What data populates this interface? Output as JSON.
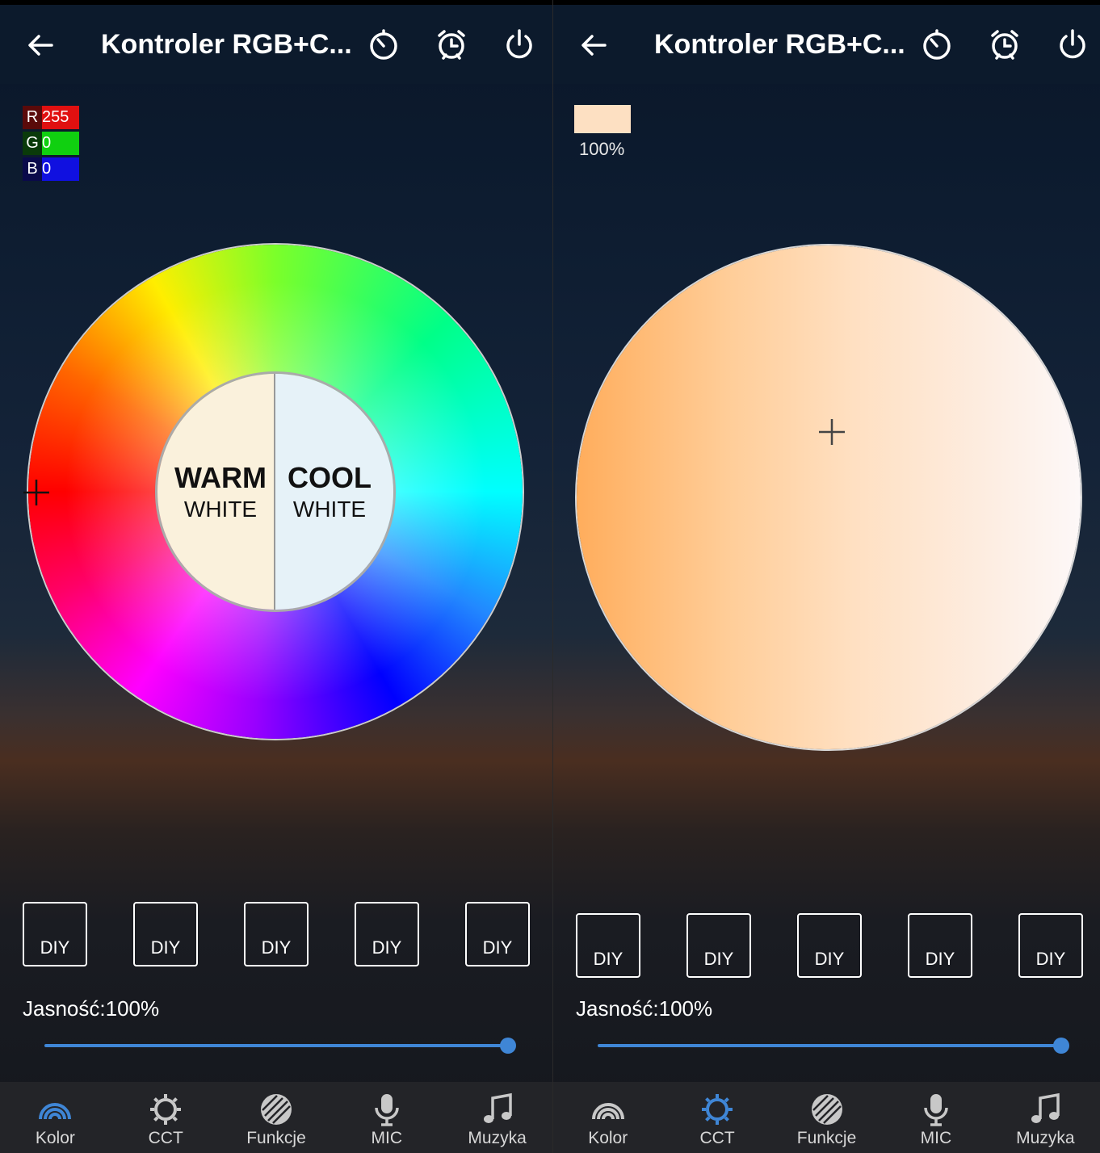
{
  "colors": {
    "accent": "#3f86d6",
    "appbar": "#0c1a2c",
    "nav_bg": "#232428",
    "inactive_icon": "#c8c8c8"
  },
  "left": {
    "app_title": "Kontroler RGB+C...",
    "rgb": {
      "r_label": "R",
      "r_value": "255",
      "g_label": "G",
      "g_value": "0",
      "b_label": "B",
      "b_value": "0"
    },
    "warm": {
      "line1": "WARM",
      "line2": "WHITE"
    },
    "cool": {
      "line1": "COOL",
      "line2": "WHITE"
    },
    "diy": [
      "DIY",
      "DIY",
      "DIY",
      "DIY",
      "DIY"
    ],
    "brightness_label": "Jasność:100%",
    "brightness_value": 1.0,
    "active_tab": "Kolor"
  },
  "right": {
    "app_title": "Kontroler RGB+C...",
    "swatch_color": "#fde0c2",
    "swatch_percent": "100%",
    "diy": [
      "DIY",
      "DIY",
      "DIY",
      "DIY",
      "DIY"
    ],
    "brightness_label": "Jasność:100%",
    "brightness_value": 1.0,
    "active_tab": "CCT"
  },
  "tabs": [
    {
      "label": "Kolor",
      "icon": "rainbow-icon"
    },
    {
      "label": "CCT",
      "icon": "sun-gear-icon"
    },
    {
      "label": "Funkcje",
      "icon": "striped-circle-icon"
    },
    {
      "label": "MIC",
      "icon": "microphone-icon"
    },
    {
      "label": "Muzyka",
      "icon": "music-note-icon"
    }
  ]
}
